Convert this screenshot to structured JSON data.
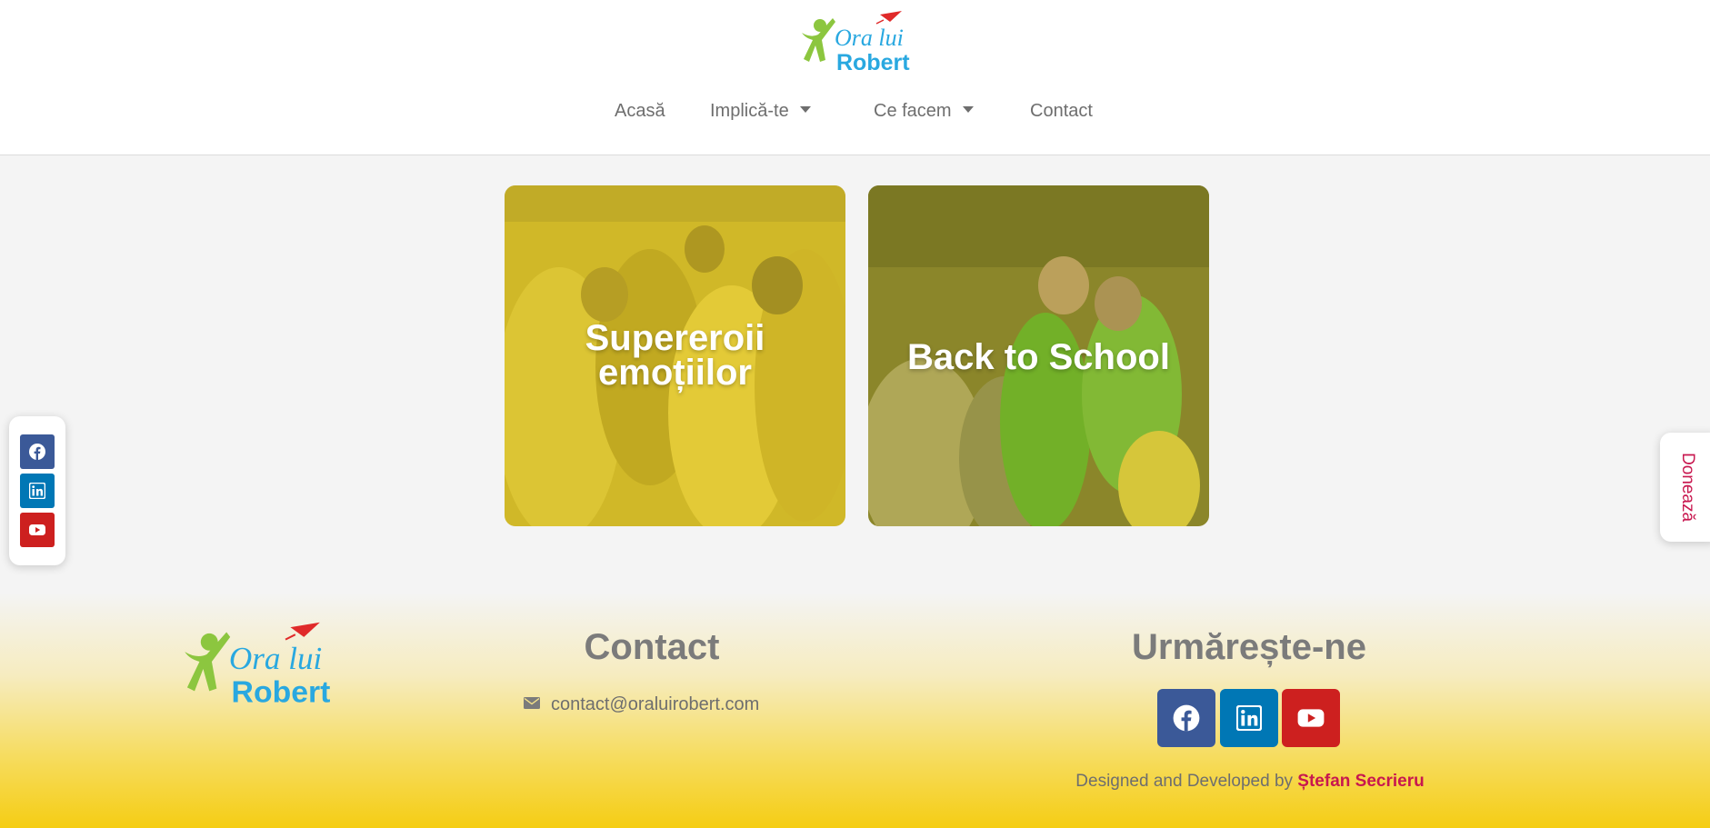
{
  "brand": {
    "logo_line1": "Ora lui",
    "logo_line2": "Robert"
  },
  "colors": {
    "logo_green": "#8cc63f",
    "logo_blue": "#29a8e0",
    "logo_plane": "#e02a2a",
    "facebook": "#3b5998",
    "linkedin": "#0077b5",
    "youtube": "#cd201f",
    "accent_pink": "#c8174f",
    "footer_yellow": "#f5cd14"
  },
  "nav": {
    "items": [
      {
        "label": "Acasă",
        "has_dropdown": false
      },
      {
        "label": "Implică-te",
        "has_dropdown": true
      },
      {
        "label": "Ce facem",
        "has_dropdown": true
      },
      {
        "label": "Contact",
        "has_dropdown": false
      }
    ]
  },
  "cards": [
    {
      "line1": "Supereroii",
      "line2": "emoțiilor",
      "overlay": "yellow"
    },
    {
      "line1": "Back to School",
      "line2": "",
      "overlay": "olive"
    }
  ],
  "float_social": {
    "icons": [
      "facebook-icon",
      "linkedin-icon",
      "youtube-icon"
    ]
  },
  "donate": {
    "label": "Donează"
  },
  "footer": {
    "contact_heading": "Contact",
    "email": "contact@oraluirobert.com",
    "follow_heading": "Urmărește-ne",
    "social_icons": [
      "facebook-icon",
      "linkedin-icon",
      "youtube-icon"
    ],
    "credit_prefix": "Designed and Developed by",
    "credit_author": "Ștefan Secrieru"
  }
}
